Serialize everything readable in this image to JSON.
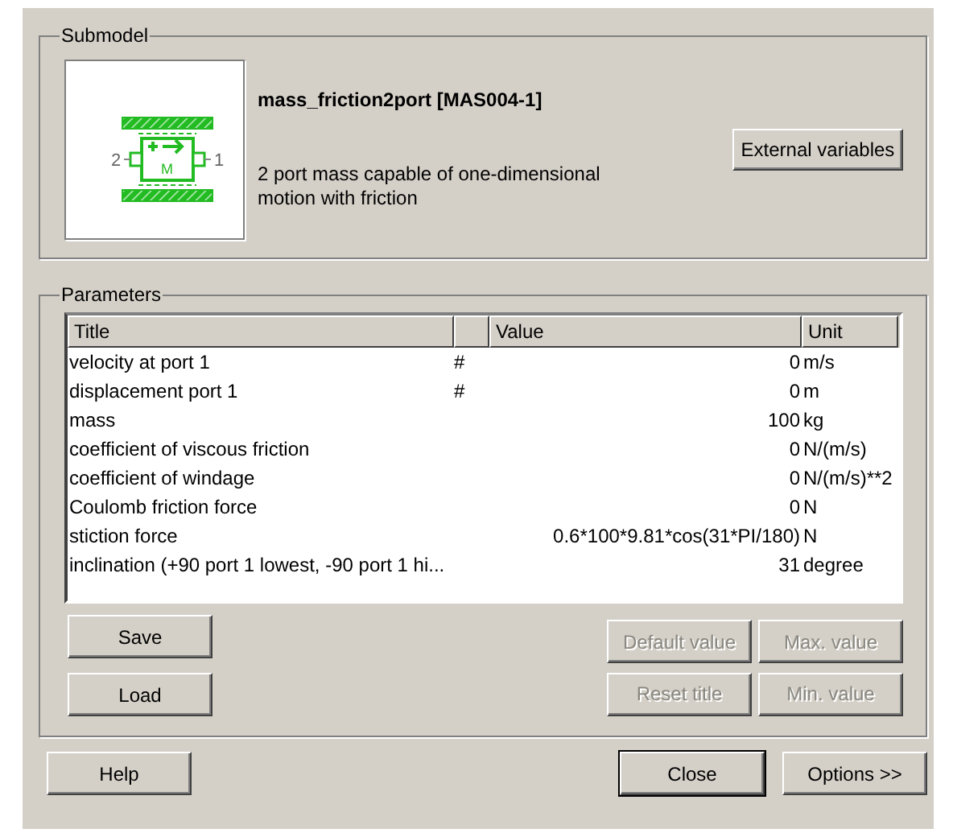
{
  "submodel": {
    "title": "Submodel",
    "symbol": {
      "left_port": "2",
      "right_port": "1",
      "label": "M"
    },
    "name": "mass_friction2port [MAS004-1]",
    "description": "2 port mass capable of one-dimensional motion with friction",
    "button": "External variables"
  },
  "parameters": {
    "title": "Parameters",
    "columns": [
      {
        "label": "Title"
      },
      {
        "label": "Value"
      },
      {
        "label": "Unit"
      }
    ],
    "rows": [
      {
        "title": "velocity at port 1",
        "flag": "#",
        "value": "0",
        "unit": "m/s"
      },
      {
        "title": "displacement port 1",
        "flag": "#",
        "value": "0",
        "unit": "m"
      },
      {
        "title": "mass",
        "value": "100",
        "unit": "kg"
      },
      {
        "title": "coefficient of viscous friction",
        "value": "0",
        "unit": "N/(m/s)"
      },
      {
        "title": "coefficient of windage",
        "value": "0",
        "unit": "N/(m/s)**2"
      },
      {
        "title": "Coulomb friction force",
        "value": "0",
        "unit": "N"
      },
      {
        "title": "stiction force",
        "value": "0.6*100*9.81*cos(31*PI/180)",
        "unit": "N"
      },
      {
        "title": "inclination (+90 port 1 lowest, -90 port 1 hi...",
        "value": "31",
        "unit": "degree"
      }
    ],
    "left_buttons": [
      {
        "label": "Save",
        "disabled": false
      },
      {
        "label": "Load",
        "disabled": false
      }
    ],
    "right_buttons": [
      {
        "label": "Default value",
        "disabled": true
      },
      {
        "label": "Max. value",
        "disabled": true
      },
      {
        "label": "Reset title",
        "disabled": true
      },
      {
        "label": "Min. value",
        "disabled": true
      }
    ]
  },
  "footer": {
    "left": [
      {
        "label": "Help",
        "default": false
      }
    ],
    "right": [
      {
        "label": "Close",
        "default": true
      },
      {
        "label": "Options >>",
        "default": false
      }
    ]
  }
}
